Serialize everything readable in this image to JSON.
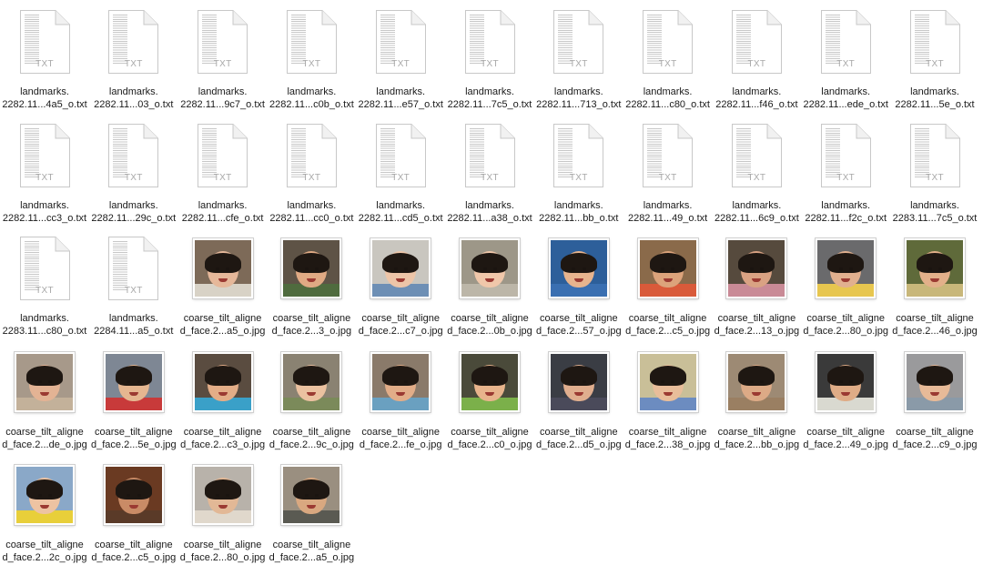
{
  "files": [
    {
      "type": "txt",
      "name1": "landmarks.",
      "name2": "2282.11...4a5_o.txt"
    },
    {
      "type": "txt",
      "name1": "landmarks.",
      "name2": "2282.11...03_o.txt"
    },
    {
      "type": "txt",
      "name1": "landmarks.",
      "name2": "2282.11...9c7_o.txt"
    },
    {
      "type": "txt",
      "name1": "landmarks.",
      "name2": "2282.11...c0b_o.txt"
    },
    {
      "type": "txt",
      "name1": "landmarks.",
      "name2": "2282.11...e57_o.txt"
    },
    {
      "type": "txt",
      "name1": "landmarks.",
      "name2": "2282.11...7c5_o.txt"
    },
    {
      "type": "txt",
      "name1": "landmarks.",
      "name2": "2282.11...713_o.txt"
    },
    {
      "type": "txt",
      "name1": "landmarks.",
      "name2": "2282.11...c80_o.txt"
    },
    {
      "type": "txt",
      "name1": "landmarks.",
      "name2": "2282.11...f46_o.txt"
    },
    {
      "type": "txt",
      "name1": "landmarks.",
      "name2": "2282.11...ede_o.txt"
    },
    {
      "type": "txt",
      "name1": "landmarks.",
      "name2": "2282.11...5e_o.txt"
    },
    {
      "type": "txt",
      "name1": "landmarks.",
      "name2": "2282.11...cc3_o.txt"
    },
    {
      "type": "txt",
      "name1": "landmarks.",
      "name2": "2282.11...29c_o.txt"
    },
    {
      "type": "txt",
      "name1": "landmarks.",
      "name2": "2282.11...cfe_o.txt"
    },
    {
      "type": "txt",
      "name1": "landmarks.",
      "name2": "2282.11...cc0_o.txt"
    },
    {
      "type": "txt",
      "name1": "landmarks.",
      "name2": "2282.11...cd5_o.txt"
    },
    {
      "type": "txt",
      "name1": "landmarks.",
      "name2": "2282.11...a38_o.txt"
    },
    {
      "type": "txt",
      "name1": "landmarks.",
      "name2": "2282.11...bb_o.txt"
    },
    {
      "type": "txt",
      "name1": "landmarks.",
      "name2": "2282.11...49_o.txt"
    },
    {
      "type": "txt",
      "name1": "landmarks.",
      "name2": "2282.11...6c9_o.txt"
    },
    {
      "type": "txt",
      "name1": "landmarks.",
      "name2": "2282.11...f2c_o.txt"
    },
    {
      "type": "txt",
      "name1": "landmarks.",
      "name2": "2283.11...7c5_o.txt"
    },
    {
      "type": "txt",
      "name1": "landmarks.",
      "name2": "2283.11...c80_o.txt"
    },
    {
      "type": "txt",
      "name1": "landmarks.",
      "name2": "2284.11...a5_o.txt"
    },
    {
      "type": "jpg",
      "name1": "coarse_tilt_aligne",
      "name2": "d_face.2...a5_o.jpg",
      "bg": "#7d6a58",
      "skin": "#e6b89a",
      "shirt": "#d8d2c6"
    },
    {
      "type": "jpg",
      "name1": "coarse_tilt_aligne",
      "name2": "d_face.2...3_o.jpg",
      "bg": "#5e5346",
      "skin": "#e0aa84",
      "shirt": "#4f6b3e"
    },
    {
      "type": "jpg",
      "name1": "coarse_tilt_aligne",
      "name2": "d_face.2...c7_o.jpg",
      "bg": "#c9c6bf",
      "skin": "#edc5a8",
      "shirt": "#6d8fb5"
    },
    {
      "type": "jpg",
      "name1": "coarse_tilt_aligne",
      "name2": "d_face.2...0b_o.jpg",
      "bg": "#9d9788",
      "skin": "#f0c7aa",
      "shirt": "#bcb6a8"
    },
    {
      "type": "jpg",
      "name1": "coarse_tilt_aligne",
      "name2": "d_face.2...57_o.jpg",
      "bg": "#2d5f9a",
      "skin": "#e7b48e",
      "shirt": "#3a6fb1"
    },
    {
      "type": "jpg",
      "name1": "coarse_tilt_aligne",
      "name2": "d_face.2...c5_o.jpg",
      "bg": "#8a6a4a",
      "skin": "#dca37b",
      "shirt": "#d95a3a"
    },
    {
      "type": "jpg",
      "name1": "coarse_tilt_aligne",
      "name2": "d_face.2...13_o.jpg",
      "bg": "#564a3d",
      "skin": "#d9a283",
      "shirt": "#c98a96"
    },
    {
      "type": "jpg",
      "name1": "coarse_tilt_aligne",
      "name2": "d_face.2...80_o.jpg",
      "bg": "#6a6a6c",
      "skin": "#e1b08f",
      "shirt": "#e7c64f"
    },
    {
      "type": "jpg",
      "name1": "coarse_tilt_aligne",
      "name2": "d_face.2...46_o.jpg",
      "bg": "#5f6a3a",
      "skin": "#e3b08a",
      "shirt": "#c8b77a"
    },
    {
      "type": "jpg",
      "name1": "coarse_tilt_aligne",
      "name2": "d_face.2...de_o.jpg",
      "bg": "#a7998a",
      "skin": "#e3b394",
      "shirt": "#c3b19a"
    },
    {
      "type": "jpg",
      "name1": "coarse_tilt_aligne",
      "name2": "d_face.2...5e_o.jpg",
      "bg": "#7e8794",
      "skin": "#e5b690",
      "shirt": "#c83a3a"
    },
    {
      "type": "jpg",
      "name1": "coarse_tilt_aligne",
      "name2": "d_face.2...c3_o.jpg",
      "bg": "#5a4c40",
      "skin": "#e3ad87",
      "shirt": "#3aa0c8"
    },
    {
      "type": "jpg",
      "name1": "coarse_tilt_aligne",
      "name2": "d_face.2...9c_o.jpg",
      "bg": "#8a8272",
      "skin": "#ebc1a0",
      "shirt": "#7b8a5a"
    },
    {
      "type": "jpg",
      "name1": "coarse_tilt_aligne",
      "name2": "d_face.2...fe_o.jpg",
      "bg": "#8a7a6a",
      "skin": "#e2ad88",
      "shirt": "#6aa0c0"
    },
    {
      "type": "jpg",
      "name1": "coarse_tilt_aligne",
      "name2": "d_face.2...c0_o.jpg",
      "bg": "#4a4a3a",
      "skin": "#e8b48c",
      "shirt": "#7bb04a"
    },
    {
      "type": "jpg",
      "name1": "coarse_tilt_aligne",
      "name2": "d_face.2...d5_o.jpg",
      "bg": "#3a3d44",
      "skin": "#e0ae8e",
      "shirt": "#4a4a5a"
    },
    {
      "type": "jpg",
      "name1": "coarse_tilt_aligne",
      "name2": "d_face.2...38_o.jpg",
      "bg": "#c9bf98",
      "skin": "#e8bd9a",
      "shirt": "#6c8cc0"
    },
    {
      "type": "jpg",
      "name1": "coarse_tilt_aligne",
      "name2": "d_face.2...bb_o.jpg",
      "bg": "#9d8a74",
      "skin": "#dcaa86",
      "shirt": "#9a7f62"
    },
    {
      "type": "jpg",
      "name1": "coarse_tilt_aligne",
      "name2": "d_face.2...49_o.jpg",
      "bg": "#3a3a3a",
      "skin": "#dfac86",
      "shirt": "#d9d9d0"
    },
    {
      "type": "jpg",
      "name1": "coarse_tilt_aligne",
      "name2": "d_face.2...c9_o.jpg",
      "bg": "#9a9a9c",
      "skin": "#e7ba98",
      "shirt": "#8a9aa8"
    },
    {
      "type": "jpg",
      "name1": "coarse_tilt_aligne",
      "name2": "d_face.2...2c_o.jpg",
      "bg": "#8aa8c8",
      "skin": "#edc3a2",
      "shirt": "#e8cf3a"
    },
    {
      "type": "jpg",
      "name1": "coarse_tilt_aligne",
      "name2": "d_face.2...c5_o.jpg",
      "bg": "#6a3a22",
      "skin": "#c98b66",
      "shirt": "#5a3a28"
    },
    {
      "type": "jpg",
      "name1": "coarse_tilt_aligne",
      "name2": "d_face.2...80_o.jpg",
      "bg": "#b8b2aa",
      "skin": "#e2b896",
      "shirt": "#e0d8cc"
    },
    {
      "type": "jpg",
      "name1": "coarse_tilt_aligne",
      "name2": "d_face.2...a5_o.jpg",
      "bg": "#9a8f80",
      "skin": "#d9a880",
      "shirt": "#5a5a52"
    }
  ]
}
